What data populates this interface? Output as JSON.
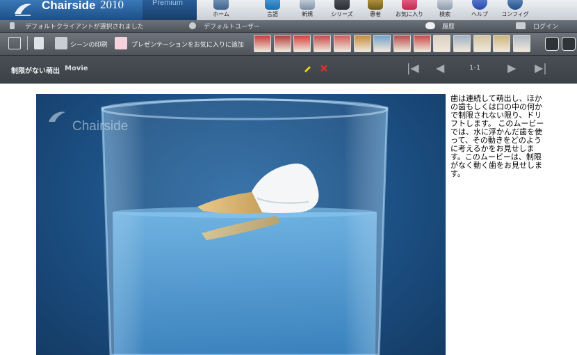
{
  "app": {
    "brand_name": "Chairside",
    "brand_year": "2010",
    "edition": "Premium"
  },
  "nav": [
    {
      "label": "ホーム",
      "icon": "home-icon"
    },
    {
      "label": "言語",
      "icon": "language-icon"
    },
    {
      "label": "新規",
      "icon": "new-icon"
    },
    {
      "label": "シリーズ",
      "icon": "series-icon"
    },
    {
      "label": "患者",
      "icon": "patient-icon"
    },
    {
      "label": "お気に入り",
      "icon": "favorites-icon"
    },
    {
      "label": "検索",
      "icon": "search-icon"
    },
    {
      "label": "ヘルプ",
      "icon": "help-icon"
    },
    {
      "label": "コンフィグ",
      "icon": "config-icon"
    }
  ],
  "status": {
    "client": "デフォルトクライアントが選択されました",
    "user": "デフォルトユーザー",
    "history": "履歴",
    "login": "ログイン"
  },
  "toolbar": {
    "print_label": "シーンの印刷",
    "add_favorite_label": "プレゼンテーションをお気に入りに追加",
    "thumb_colors": [
      "#c43a3a",
      "#b23a3a",
      "#d23d3d",
      "#c9474a",
      "#cf5a5a",
      "#c48a3a",
      "#6fa1c9",
      "#b84a4a",
      "#c84646",
      "#d9d0c4",
      "#9fb1c3",
      "#d2c39f",
      "#cbb37a",
      "#aeb9c4"
    ]
  },
  "scene": {
    "title": "制限がない萌出",
    "type": "Movie",
    "pager": "1-1",
    "watermark": "Chairside",
    "accent_edit": "#f3d21b",
    "accent_delete": "#e0322a"
  },
  "description": "歯は連続して萌出し、ほかの歯もしくは口の中の何かで制限されない限り、ドリフトします。 このムービーでは、水に浮かんだ歯を使って、その動きをどのように考えるかをお見せします。このムービーは、制限がなく動く歯をお見せします。"
}
